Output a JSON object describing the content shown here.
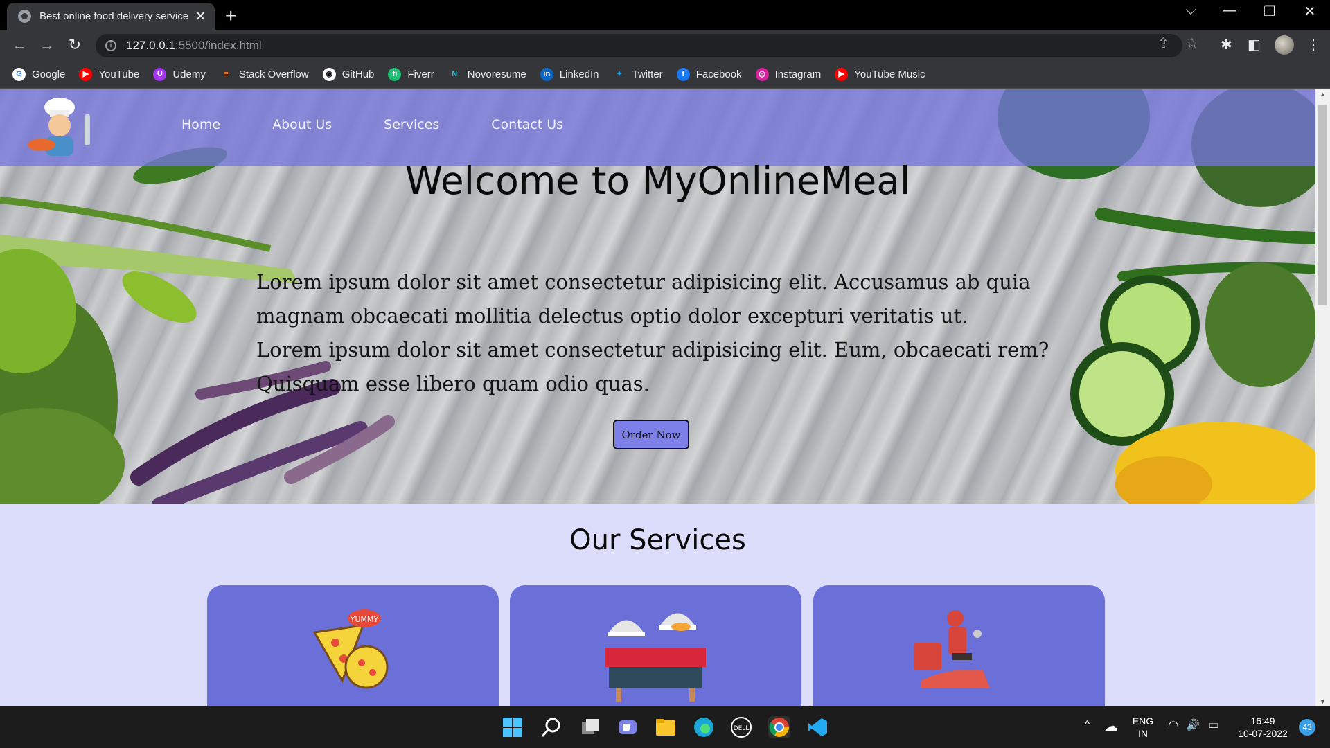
{
  "browser": {
    "tab_title": "Best online food delivery service",
    "tab_close": "✕",
    "new_tab": "+",
    "url_host": "127.0.0.1",
    "url_rest": ":5500/index.html",
    "info_glyph": "i",
    "window_controls": {
      "dropdown": "⌵",
      "minimize": "—",
      "restore": "❐",
      "close": "✕"
    },
    "nav": {
      "back": "←",
      "forward": "→",
      "reload": "↻"
    },
    "toolbar_icons": {
      "share": "⇪",
      "star": "☆",
      "extensions": "✱",
      "sidepanel": "◧",
      "menu": "⋮"
    }
  },
  "bookmarks": [
    {
      "label": "Google",
      "icon": "google-icon",
      "color": "#ffffff",
      "glyph": "G",
      "glyph_color": "#4285f4"
    },
    {
      "label": "YouTube",
      "icon": "youtube-icon",
      "color": "#ff0000",
      "glyph": "▶",
      "glyph_color": "#ffffff"
    },
    {
      "label": "Udemy",
      "icon": "udemy-icon",
      "color": "#a435f0",
      "glyph": "U",
      "glyph_color": "#ffffff"
    },
    {
      "label": "Stack Overflow",
      "icon": "stackoverflow-icon",
      "color": "#35363a",
      "glyph": "≡",
      "glyph_color": "#f48024"
    },
    {
      "label": "GitHub",
      "icon": "github-icon",
      "color": "#ffffff",
      "glyph": "◉",
      "glyph_color": "#000000"
    },
    {
      "label": "Fiverr",
      "icon": "fiverr-icon",
      "color": "#1dbf73",
      "glyph": "fi",
      "glyph_color": "#ffffff"
    },
    {
      "label": "Novoresume",
      "icon": "novoresume-icon",
      "color": "#35363a",
      "glyph": "N",
      "glyph_color": "#21c6d1"
    },
    {
      "label": "LinkedIn",
      "icon": "linkedin-icon",
      "color": "#0a66c2",
      "glyph": "in",
      "glyph_color": "#ffffff"
    },
    {
      "label": "Twitter",
      "icon": "twitter-icon",
      "color": "#35363a",
      "glyph": "✦",
      "glyph_color": "#1da1f2"
    },
    {
      "label": "Facebook",
      "icon": "facebook-icon",
      "color": "#1877f2",
      "glyph": "f",
      "glyph_color": "#ffffff"
    },
    {
      "label": "Instagram",
      "icon": "instagram-icon",
      "color": "#d6249f",
      "glyph": "◎",
      "glyph_color": "#ffffff"
    },
    {
      "label": "YouTube Music",
      "icon": "youtube-music-icon",
      "color": "#ff0000",
      "glyph": "▶",
      "glyph_color": "#ffffff"
    }
  ],
  "site": {
    "nav": [
      "Home",
      "About Us",
      "Services",
      "Contact Us"
    ],
    "hero_title": "Welcome to MyOnlineMeal",
    "hero_paragraph_1": "Lorem ipsum dolor sit amet consectetur adipisicing elit. Accusamus ab quia magnam obcaecati mollitia delectus optio dolor excepturi veritatis ut.",
    "hero_paragraph_2": "Lorem ipsum dolor sit amet consectetur adipisicing elit. Eum, obcaecati rem? Quisquam esse libero quam odio quas.",
    "order_button": "Order Now",
    "services_title": "Our Services",
    "yummy_text": "YUMMY",
    "colors": {
      "navbar": "#7575da",
      "page_bg": "#dcdcfb",
      "card": "#6b6fd8",
      "button": "#7c80e8"
    }
  },
  "taskbar": {
    "apps": [
      "windows-start-icon",
      "search-icon",
      "task-view-icon",
      "teams-chat-icon",
      "file-explorer-icon",
      "edge-icon",
      "dell-icon",
      "chrome-icon",
      "vscode-icon"
    ],
    "dell_label": "DELL",
    "language": "ENG",
    "region": "IN",
    "time": "16:49",
    "date": "10-07-2022",
    "notifications": "43",
    "tray_glyphs": {
      "chevron": "^",
      "cloud": "☁",
      "wifi": "◠",
      "volume": "🔊",
      "battery": "▭"
    }
  }
}
